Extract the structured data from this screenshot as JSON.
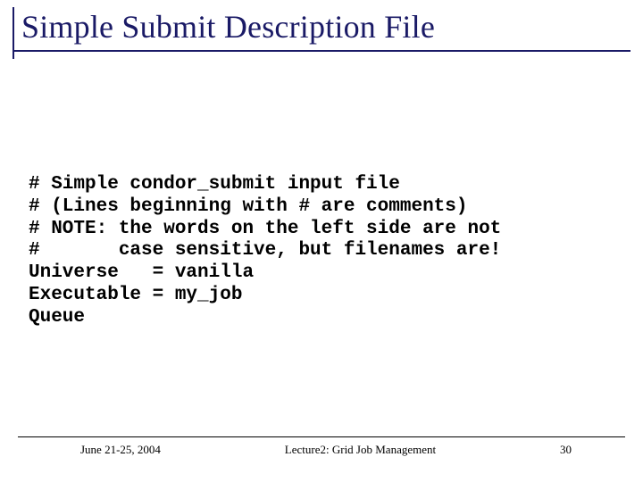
{
  "title": "Simple Submit Description File",
  "code": {
    "l1": "# Simple condor_submit input file",
    "l2": "# (Lines beginning with # are comments)",
    "l3": "# NOTE: the words on the left side are not",
    "l4": "#       case sensitive, but filenames are!",
    "l5": "Universe   = vanilla",
    "l6": "Executable = my_job",
    "l7": "Queue"
  },
  "footer": {
    "date": "June 21-25, 2004",
    "center": "Lecture2: Grid Job Management",
    "page": "30"
  }
}
